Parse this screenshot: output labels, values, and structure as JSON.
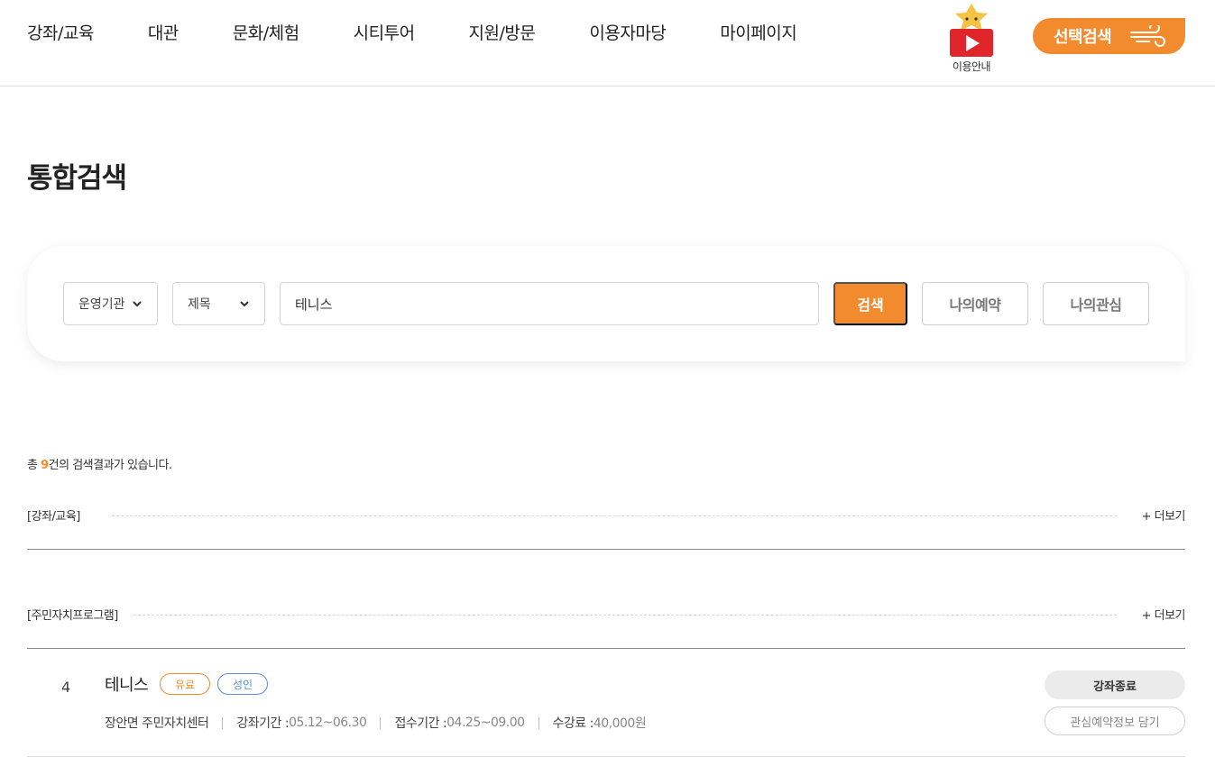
{
  "colors": {
    "accent": "#f28a2e",
    "adult_tag": "#5b8fd6",
    "text": "#222222"
  },
  "header": {
    "nav": [
      "강좌/교육",
      "대관",
      "문화/체험",
      "시티투어",
      "지원/방문",
      "이용자마당",
      "마이페이지"
    ],
    "guide_icon": "play-mascot-icon",
    "guide_label": "이용안내",
    "select_search_label": "선택검색",
    "select_search_icon": "wind-icon"
  },
  "page": {
    "title": "통합검색"
  },
  "search": {
    "org_select": "운영기관",
    "field_select": "제목",
    "query": "테니스",
    "search_button": "검색",
    "my_reservation_button": "나의예약",
    "my_interest_button": "나의관심"
  },
  "results": {
    "count_prefix": "총 ",
    "count": "9",
    "count_suffix": "건의 검색결과가 있습니다.",
    "more_label": "+ 더보기",
    "categories": [
      {
        "label": "[강좌/교육]"
      },
      {
        "label": "[주민자치프로그램]"
      }
    ],
    "items": [
      {
        "no": "4",
        "title": "테니스",
        "tag_paid": "유료",
        "tag_target": "성인",
        "center": "장안면 주민자치센터",
        "course_period_label": "강좌기간 : ",
        "course_period": "05.12~06.30",
        "reception_label": "접수기간 : ",
        "reception_period": "04.25~09.00",
        "fee_label": "수강료 : ",
        "fee": "40,000원",
        "status_button": "강좌종료",
        "fav_button": "관심예약정보 담기"
      }
    ]
  }
}
